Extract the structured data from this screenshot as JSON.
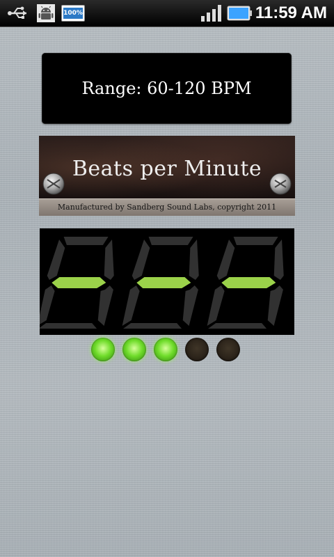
{
  "status_bar": {
    "time": "11:59 AM",
    "battery_app_label": "100%",
    "icons": [
      "usb-icon",
      "android-debug-icon",
      "battery-widget-icon",
      "signal-icon",
      "battery-icon"
    ]
  },
  "range": {
    "label": "Range: 60-120 BPM"
  },
  "plate": {
    "title": "Beats per Minute",
    "footer": "Manufactured by Sandberg Sound Labs, copyright 2011"
  },
  "display": {
    "digits": [
      "-",
      "-",
      "-"
    ],
    "active_color": "#9bd24a",
    "inactive_color": "#5a5a5a"
  },
  "leds": {
    "states": [
      true,
      true,
      true,
      false,
      false
    ],
    "on_color": "#6fdc2a",
    "off_color": "#2a2219"
  },
  "colors": {
    "range_bg": "#000000",
    "status_bar_bg": "#111111"
  }
}
